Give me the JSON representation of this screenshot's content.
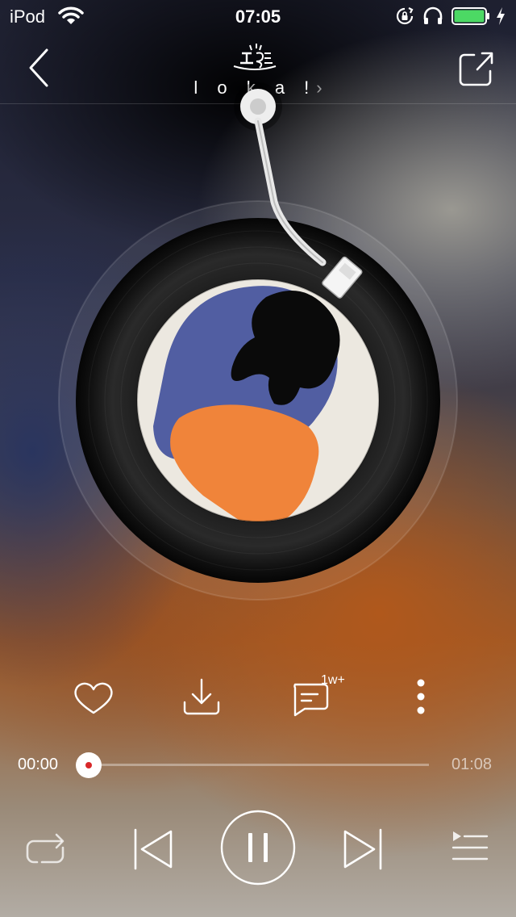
{
  "status_bar": {
    "carrier": "iPod",
    "time": "07:05",
    "icons": [
      "wifi-icon",
      "rotation-lock-icon",
      "headphones-icon",
      "battery-icon",
      "charging-icon"
    ],
    "battery_color": "#4cd964",
    "battery_level": 1.0
  },
  "nav": {
    "title": "l o k a !",
    "chevron": "›",
    "back_icon": "back-chevron-icon",
    "share_icon": "share-icon"
  },
  "player": {
    "accent": "#d8282a",
    "current_time": "00:00",
    "duration": "01:08",
    "progress": 0.0
  },
  "actions": {
    "icons": [
      "heart-icon",
      "download-icon",
      "comment-icon",
      "more-icon"
    ],
    "comment_count": "1w+"
  },
  "controls": {
    "icons": [
      "repeat-icon",
      "previous-icon",
      "pause-icon",
      "next-icon",
      "playlist-icon"
    ]
  }
}
